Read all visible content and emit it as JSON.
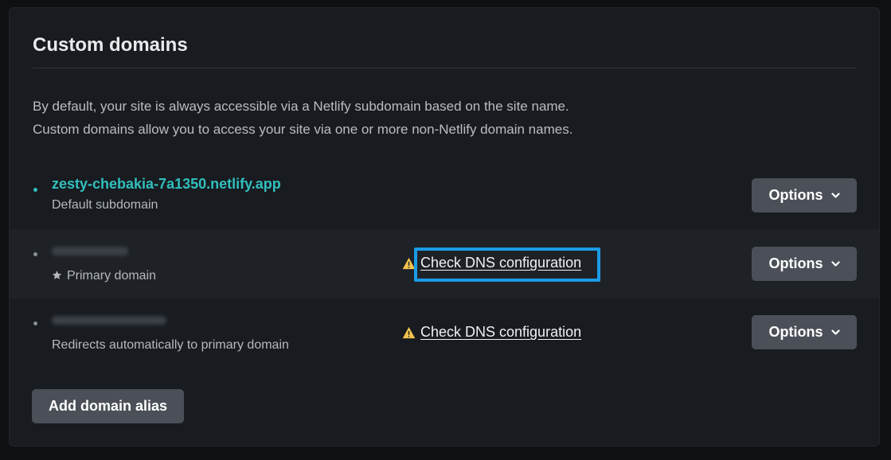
{
  "section": {
    "title": "Custom domains",
    "description_line1": "By default, your site is always accessible via a Netlify subdomain based on the site name.",
    "description_line2": "Custom domains allow you to access your site via one or more non-Netlify domain names."
  },
  "domains": [
    {
      "name": "zesty-chebakia-7a1350.netlify.app",
      "subtitle": "Default subdomain",
      "options_label": "Options"
    },
    {
      "name": "",
      "subtitle": "Primary domain",
      "dns_label": "Check DNS configuration",
      "options_label": "Options"
    },
    {
      "name": "",
      "subtitle": "Redirects automatically to primary domain",
      "dns_label": "Check DNS configuration",
      "options_label": "Options"
    }
  ],
  "add_alias_label": "Add domain alias",
  "colors": {
    "accent_teal": "#31bfbd",
    "warning_yellow": "#f3c24e",
    "highlight_blue": "#1b9ce6",
    "button_bg": "#4b5058"
  }
}
